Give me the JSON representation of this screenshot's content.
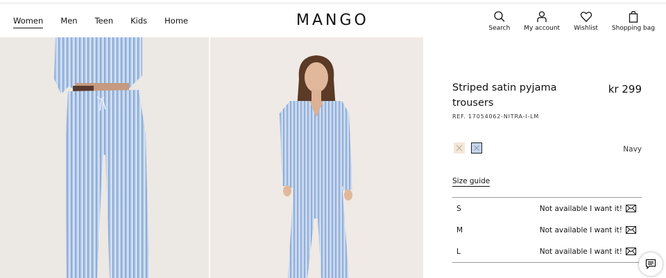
{
  "header": {
    "logo": "MANGO",
    "nav": [
      {
        "label": "Women",
        "active": true
      },
      {
        "label": "Men"
      },
      {
        "label": "Teen"
      },
      {
        "label": "Kids"
      },
      {
        "label": "Home"
      }
    ],
    "tools": {
      "search": "Search",
      "account": "My account",
      "wishlist": "Wishlist",
      "bag": "Shopping bag"
    }
  },
  "product": {
    "title": "Striped satin pyjama trousers",
    "price": "kr 299",
    "ref": "REF. 17054062-NITRA-I-LM",
    "selected_color": "Navy",
    "swatch_colors": [
      "#f3e8da",
      "#c5d6ea"
    ],
    "size_guide": "Size guide",
    "sizes": [
      {
        "size": "S",
        "status": "Not available I want it!"
      },
      {
        "size": "M",
        "status": "Not available I want it!"
      },
      {
        "size": "L",
        "status": "Not available I want it!"
      }
    ]
  },
  "colors": {
    "accent": "#111111",
    "image_bg": "#ece8e4",
    "stripe_blue": "#9fbbe0"
  },
  "icons": [
    "search-icon",
    "account-icon",
    "heart-icon",
    "bag-icon",
    "mail-icon",
    "chat-icon"
  ]
}
